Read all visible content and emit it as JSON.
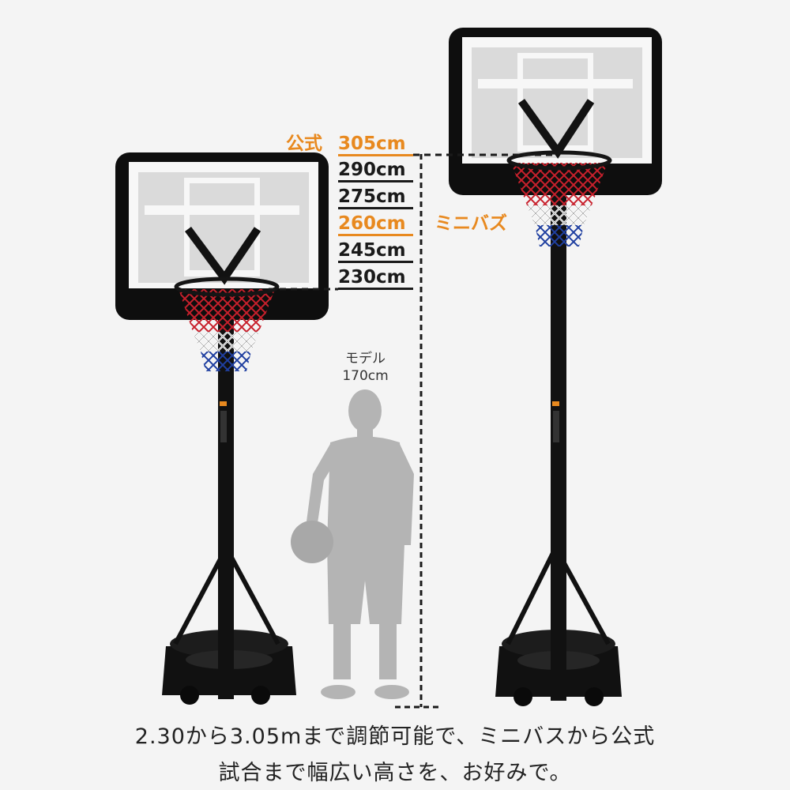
{
  "heights": {
    "official_prefix": "公式",
    "h305": "305cm",
    "h290": "290cm",
    "h275": "275cm",
    "h260": "260cm",
    "h245": "245cm",
    "h230": "230cm",
    "mini_label": "ミニバズ"
  },
  "model": {
    "line1": "モデル",
    "line2": "170cm"
  },
  "caption": {
    "line1": "2.30から3.05mまで調節可能で、ミニバスから公式",
    "line2": "試合まで幅広い高さを、お好みで。"
  },
  "colors": {
    "accent": "#e8891f",
    "text": "#1a1a1a",
    "background": "#f4f4f4",
    "silhouette": "#b4b4b4"
  }
}
